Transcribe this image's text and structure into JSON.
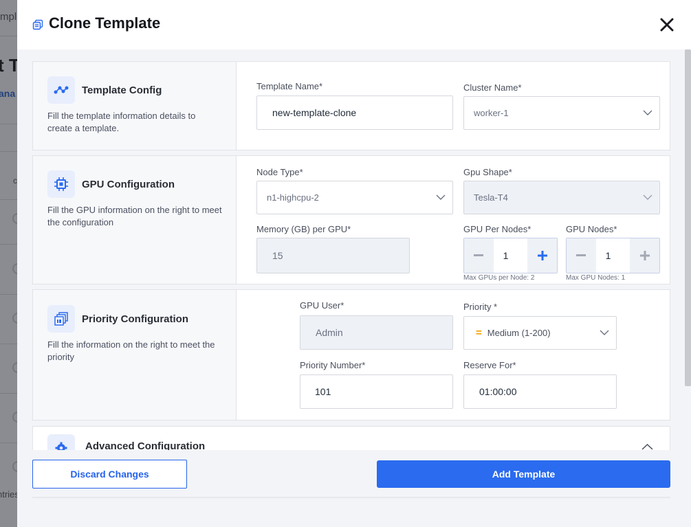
{
  "background": {
    "frag_title": "mpl",
    "frag_heading": "t T",
    "frag_tab": "ana",
    "frag_col": "c",
    "frag_entries": "ntries"
  },
  "modal": {
    "title": "Clone Template",
    "close_icon": "close-icon"
  },
  "template_config": {
    "title": "Template Config",
    "description": "Fill the template information details to create a template.",
    "template_name_label": "Template Name*",
    "template_name_value": "new-template-clone",
    "cluster_name_label": "Cluster Name*",
    "cluster_name_value": "worker-1"
  },
  "gpu_config": {
    "title": "GPU Configuration",
    "description": "Fill the GPU information on the right to meet the configuration",
    "node_type_label": "Node Type*",
    "node_type_value": "n1-highcpu-2",
    "gpu_shape_label": "Gpu Shape*",
    "gpu_shape_value": "Tesla-T4",
    "memory_label": "Memory (GB) per GPU*",
    "memory_value": "15",
    "gpu_per_nodes_label": "GPU Per Nodes*",
    "gpu_per_nodes_value": "1",
    "gpu_per_nodes_hint": "Max GPUs per Node: 2",
    "gpu_nodes_label": "GPU Nodes*",
    "gpu_nodes_value": "1",
    "gpu_nodes_hint": "Max GPU Nodes: 1"
  },
  "priority_config": {
    "title": "Priority Configuration",
    "description": "Fill the information on the right to meet the priority",
    "gpu_user_label": "GPU User*",
    "gpu_user_value": "Admin",
    "priority_label": "Priority *",
    "priority_value": "Medium (1-200)",
    "priority_symbol": "=",
    "priority_number_label": "Priority Number*",
    "priority_number_value": "101",
    "reserve_for_label": "Reserve For*",
    "reserve_for_value": "01:00:00"
  },
  "advanced_config": {
    "title": "Advanced Configuration"
  },
  "footer": {
    "discard_label": "Discard Changes",
    "add_label": "Add Template"
  },
  "colors": {
    "accent": "#2a6bef",
    "priority_medium": "#f0a000"
  }
}
